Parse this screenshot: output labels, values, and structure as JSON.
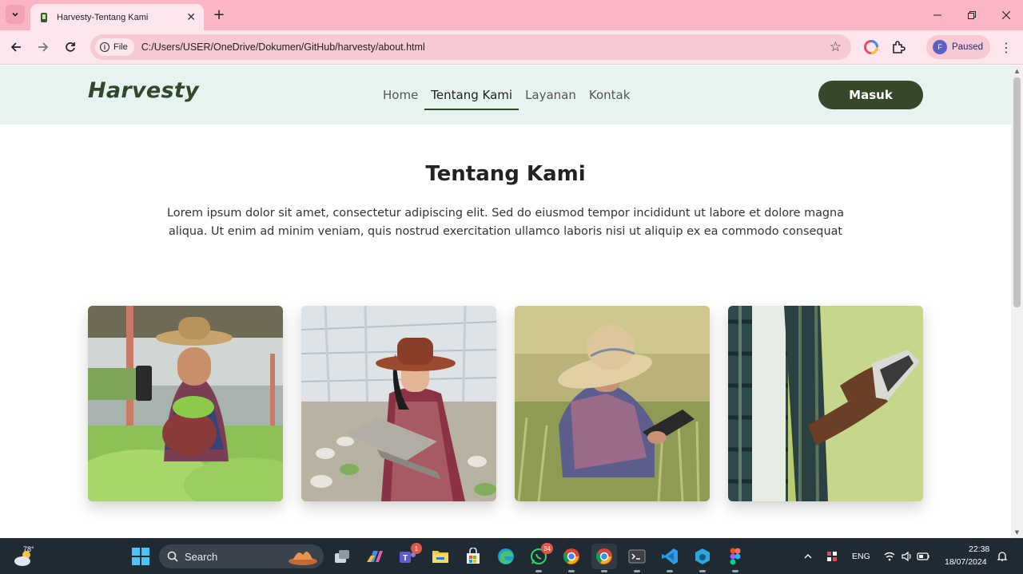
{
  "browser": {
    "tab_title": "Harvesty-Tentang Kami",
    "file_chip_label": "File",
    "url": "C:/Users/USER/OneDrive/Dokumen/GitHub/harvesty/about.html",
    "profile_initial": "F",
    "profile_status": "Paused",
    "tab_bar_color": "#fbb5c5",
    "toolbar_color": "#fde6ec"
  },
  "site": {
    "logo": "Harvesty",
    "nav_items": [
      {
        "label": "Home",
        "active": false
      },
      {
        "label": "Tentang Kami",
        "active": true
      },
      {
        "label": "Layanan",
        "active": false
      },
      {
        "label": "Kontak",
        "active": false
      }
    ],
    "login_button": "Masuk",
    "accent_color": "#36472a",
    "nav_bg_color": "#e6f4f1"
  },
  "about": {
    "title": "Tentang Kami",
    "body": "Lorem ipsum dolor sit amet, consectetur adipiscing elit. Sed do eiusmod tempor incididunt ut labore et dolore magna aliqua. Ut enim ad minim veniam, quis nostrud exercitation ullamco laboris nisi ut aliquip ex ea commodo consequat"
  },
  "cards": [
    {
      "image": "farmer-with-lettuce-and-phone-photo"
    },
    {
      "image": "farmer-with-laptop-in-greenhouse-photo"
    },
    {
      "image": "farmer-with-tablet-in-wheat-field-photo"
    },
    {
      "image": "hands-holding-phone-in-field-photo"
    }
  ],
  "taskbar": {
    "weather_temp": "78°",
    "search_label": "Search",
    "teams_badge": "1",
    "whatsapp_badge": "34",
    "language": "ENG",
    "time": "22:38",
    "date": "18/07/2024"
  }
}
